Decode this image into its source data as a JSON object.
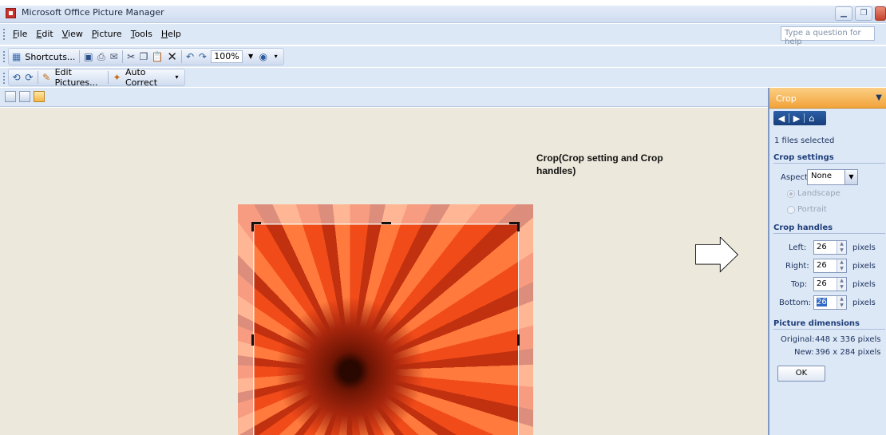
{
  "window": {
    "title": "Microsoft Office Picture Manager"
  },
  "menubar": {
    "items": [
      {
        "label": "File",
        "key": "F",
        "rest": "ile"
      },
      {
        "label": "Edit",
        "key": "E",
        "rest": "dit"
      },
      {
        "label": "View",
        "key": "V",
        "rest": "iew"
      },
      {
        "label": "Picture",
        "key": "P",
        "rest": "icture"
      },
      {
        "label": "Tools",
        "key": "T",
        "rest": "ools"
      },
      {
        "label": "Help",
        "key": "H",
        "rest": "elp"
      }
    ],
    "help_placeholder": "Type a question for help"
  },
  "toolbar": {
    "shortcuts_label": "Shortcuts...",
    "zoom_value": "100%",
    "edit_pictures_label": "Edit Pictures...",
    "auto_correct_label": "Auto Correct"
  },
  "annotation": {
    "text": "Crop(Crop setting and Crop handles)"
  },
  "task_pane": {
    "title": "Crop",
    "files_selected": "1 files selected",
    "crop_settings_heading": "Crop settings",
    "aspect_ratio_label": "Aspect ratio:",
    "aspect_ratio_value": "None",
    "landscape_label": "Landscape",
    "portrait_label": "Portrait",
    "crop_handles_heading": "Crop handles",
    "left_label": "Left:",
    "left_value": "26",
    "right_label": "Right:",
    "right_value": "26",
    "top_label": "Top:",
    "top_value": "26",
    "bottom_label": "Bottom:",
    "bottom_value": "26",
    "pixels_unit": "pixels",
    "picture_dimensions_heading": "Picture dimensions",
    "original_label": "Original:",
    "original_value": "448 x 336 pixels",
    "new_label": "New:",
    "new_value": "396 x 284 pixels",
    "ok_label": "OK"
  },
  "colors": {
    "accent": "#f2a33a",
    "chrome": "#dde8f6",
    "canvas": "#ede8dc"
  }
}
